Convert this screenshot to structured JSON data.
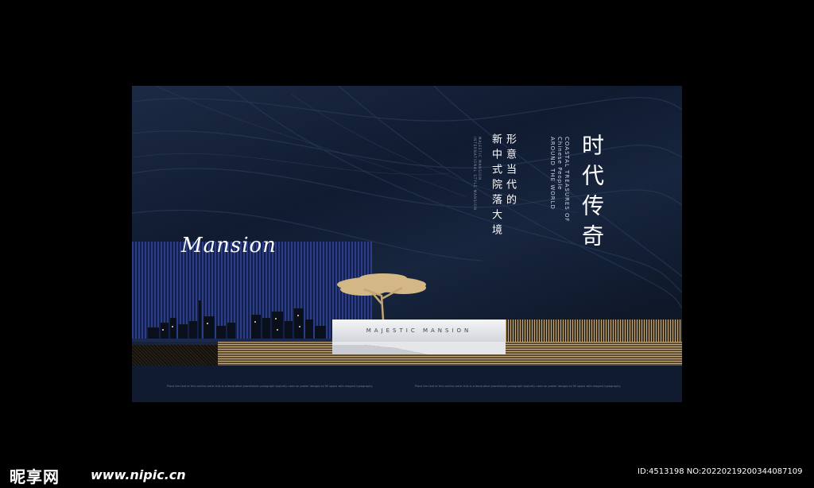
{
  "poster": {
    "title": "时代传奇",
    "subtitle_col1": "形意当代的",
    "subtitle_col2": "新中式院落大境",
    "english_col1": "COASTAL TREASURES OF",
    "english_col2": "Chinese People",
    "english_col3": "AROUND THE WORLD",
    "tiny_english_col1": "MAJESTIC MANSION",
    "tiny_english_col2": "INTERNATIONAL STYLE MANSION",
    "script_text": "Mansion",
    "plaque_text": "MAJESTIC MANSION",
    "fine_left": "Place the text of this section here: this is a decorative placeholder paragraph typically used on poster designs to fill space with elegant typography.",
    "fine_right": "Place the text of this section here: this is a decorative placeholder paragraph typically used on poster designs to fill space with elegant typography."
  },
  "watermark": {
    "brand": "昵享网",
    "url": "www.nipic.cn",
    "id_text": "ID:4513198 NO:20220219200344087109"
  },
  "colors": {
    "background": "#000000",
    "poster_navy": "#131f36",
    "gold": "#c7a877",
    "blue_stripes": "#2a3d86"
  }
}
